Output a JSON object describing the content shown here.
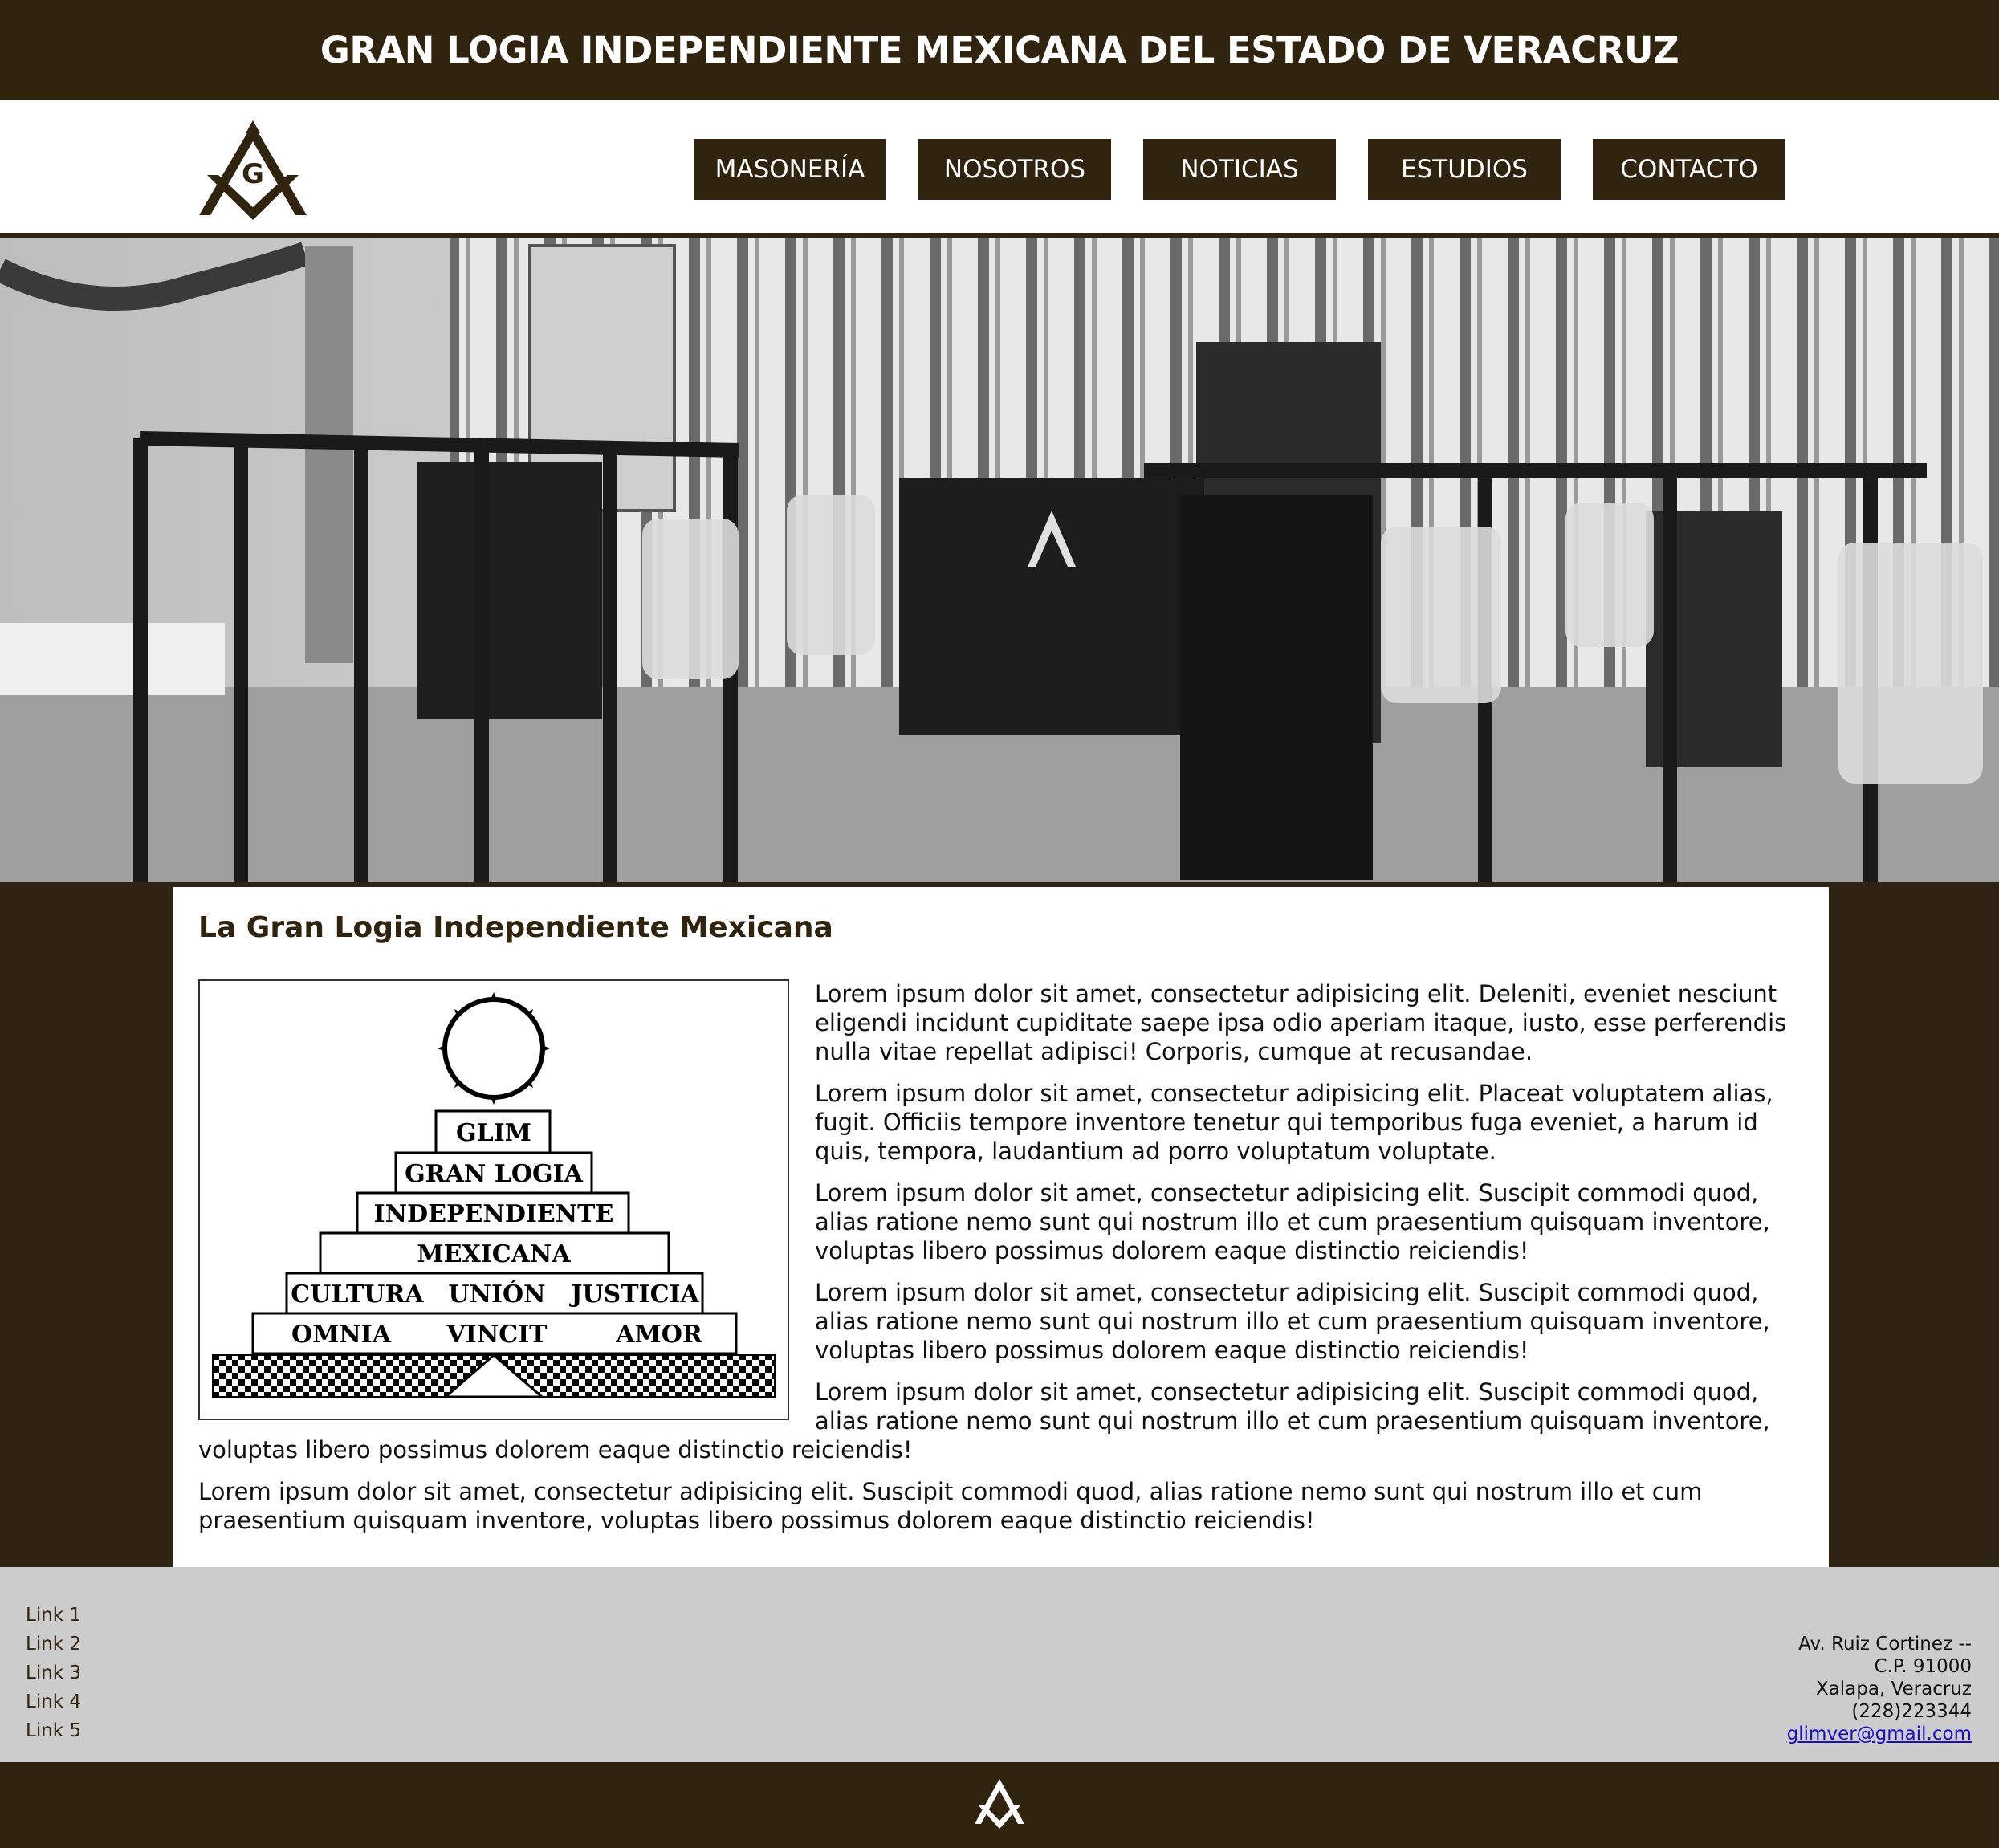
{
  "site": {
    "title": "GRAN LOGIA INDEPENDIENTE MEXICANA DEL ESTADO DE VERACRUZ",
    "logo_letter": "G"
  },
  "nav": {
    "items": [
      "MASONERÍA",
      "NOSOTROS",
      "NOTICIAS",
      "ESTUDIOS",
      "CONTACTO"
    ]
  },
  "main": {
    "title": "La Gran Logia Independiente Mexicana",
    "pyramid": {
      "rows": [
        "GLIM",
        "GRAN LOGIA",
        "INDEPENDIENTE",
        "MEXICANA"
      ],
      "row5": [
        "CULTURA",
        "UNIÓN",
        "JUSTICIA"
      ],
      "row6": [
        "OMNIA",
        "VINCIT",
        "AMOR"
      ]
    },
    "paragraphs": [
      "Lorem ipsum dolor sit amet, consectetur adipisicing elit. Deleniti, eveniet nesciunt eligendi incidunt cupiditate saepe ipsa odio aperiam itaque, iusto, esse perferendis nulla vitae repellat adipisci! Corporis, cumque at recusandae.",
      "Lorem ipsum dolor sit amet, consectetur adipisicing elit. Placeat voluptatem alias, fugit. Officiis tempore inventore tenetur qui temporibus fuga eveniet, a harum id quis, tempora, laudantium ad porro voluptatum voluptate.",
      "Lorem ipsum dolor sit amet, consectetur adipisicing elit. Suscipit commodi quod, alias ratione nemo sunt qui nostrum illo et cum praesentium quisquam inventore, voluptas libero possimus dolorem eaque distinctio reiciendis!",
      "Lorem ipsum dolor sit amet, consectetur adipisicing elit. Suscipit commodi quod, alias ratione nemo sunt qui nostrum illo et cum praesentium quisquam inventore, voluptas libero possimus dolorem eaque distinctio reiciendis!",
      "Lorem ipsum dolor sit amet, consectetur adipisicing elit. Suscipit commodi quod, alias ratione nemo sunt qui nostrum illo et cum praesentium quisquam inventore, voluptas libero possimus dolorem eaque distinctio reiciendis!",
      "Lorem ipsum dolor sit amet, consectetur adipisicing elit. Suscipit commodi quod, alias ratione nemo sunt qui nostrum illo et cum praesentium quisquam inventore, voluptas libero possimus dolorem eaque distinctio reiciendis!"
    ]
  },
  "footer": {
    "links": [
      "Link 1",
      "Link 2",
      "Link 3",
      "Link 4",
      "Link 5"
    ],
    "address": [
      "Av. Ruiz Cortinez --",
      "C.P. 91000",
      "Xalapa, Veracruz",
      "(228)223344"
    ],
    "email": "glimver@gmail.com"
  },
  "colors": {
    "brand": "#30240f",
    "footer_bg": "#cccccc",
    "link": "#1a0dcc"
  }
}
